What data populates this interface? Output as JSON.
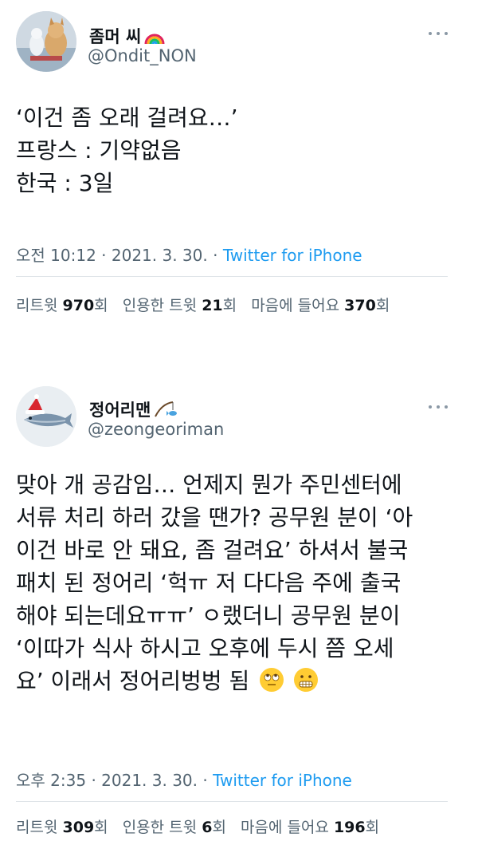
{
  "tweets": [
    {
      "author": {
        "name": "좀머 씨",
        "handle": "@Ondit_NON",
        "name_emoji": "rainbow-icon"
      },
      "body_lines": [
        "‘이건 좀 오래 걸려요…’",
        "프랑스 : 기약없음",
        "한국 : 3일"
      ],
      "meta": {
        "time": "오전 10:12",
        "date": "2021. 3. 30.",
        "source": "Twitter for iPhone"
      },
      "stats": {
        "retweets_label": "리트윗",
        "retweets": "970",
        "retweets_unit": "회",
        "quotes_label": "인용한 트윗",
        "quotes": "21",
        "quotes_unit": "회",
        "likes_label": "마음에 들어요",
        "likes": "370",
        "likes_unit": "회"
      }
    },
    {
      "author": {
        "name": "정어리맨",
        "handle": "@zeongeoriman",
        "name_emoji": "fishing-pole-icon"
      },
      "body_lines": [
        "맞아 개 공감임… 언제지 뭔가 주민센터에",
        "서류 처리 하러 갔을 땐가? 공무원 분이 ‘아",
        "이건 바로 안 돼요, 좀 걸려요’ 하셔서 불국",
        "패치 된 정어리 ‘헉ㅠ 저 다다음 주에 출국",
        "해야 되는데요ㅠㅠ’ ㅇ랬더니 공무원 분이",
        "‘이따가 식사 하시고 오후에 두시 쯤 오세",
        "요’ 이래서 정어리벙벙 됨"
      ],
      "body_emojis": [
        "eye-roll-emoji-icon",
        "grimace-emoji-icon"
      ],
      "meta": {
        "time": "오후 2:35",
        "date": "2021. 3. 30.",
        "source": "Twitter for iPhone"
      },
      "stats": {
        "retweets_label": "리트윗",
        "retweets": "309",
        "retweets_unit": "회",
        "quotes_label": "인용한 트윗",
        "quotes": "6",
        "quotes_unit": "회",
        "likes_label": "마음에 들어요",
        "likes": "196",
        "likes_unit": "회"
      }
    }
  ],
  "colors": {
    "text": "#0f1419",
    "secondary": "#536471",
    "link": "#1d9bf0",
    "divider": "#dfe4e8"
  }
}
